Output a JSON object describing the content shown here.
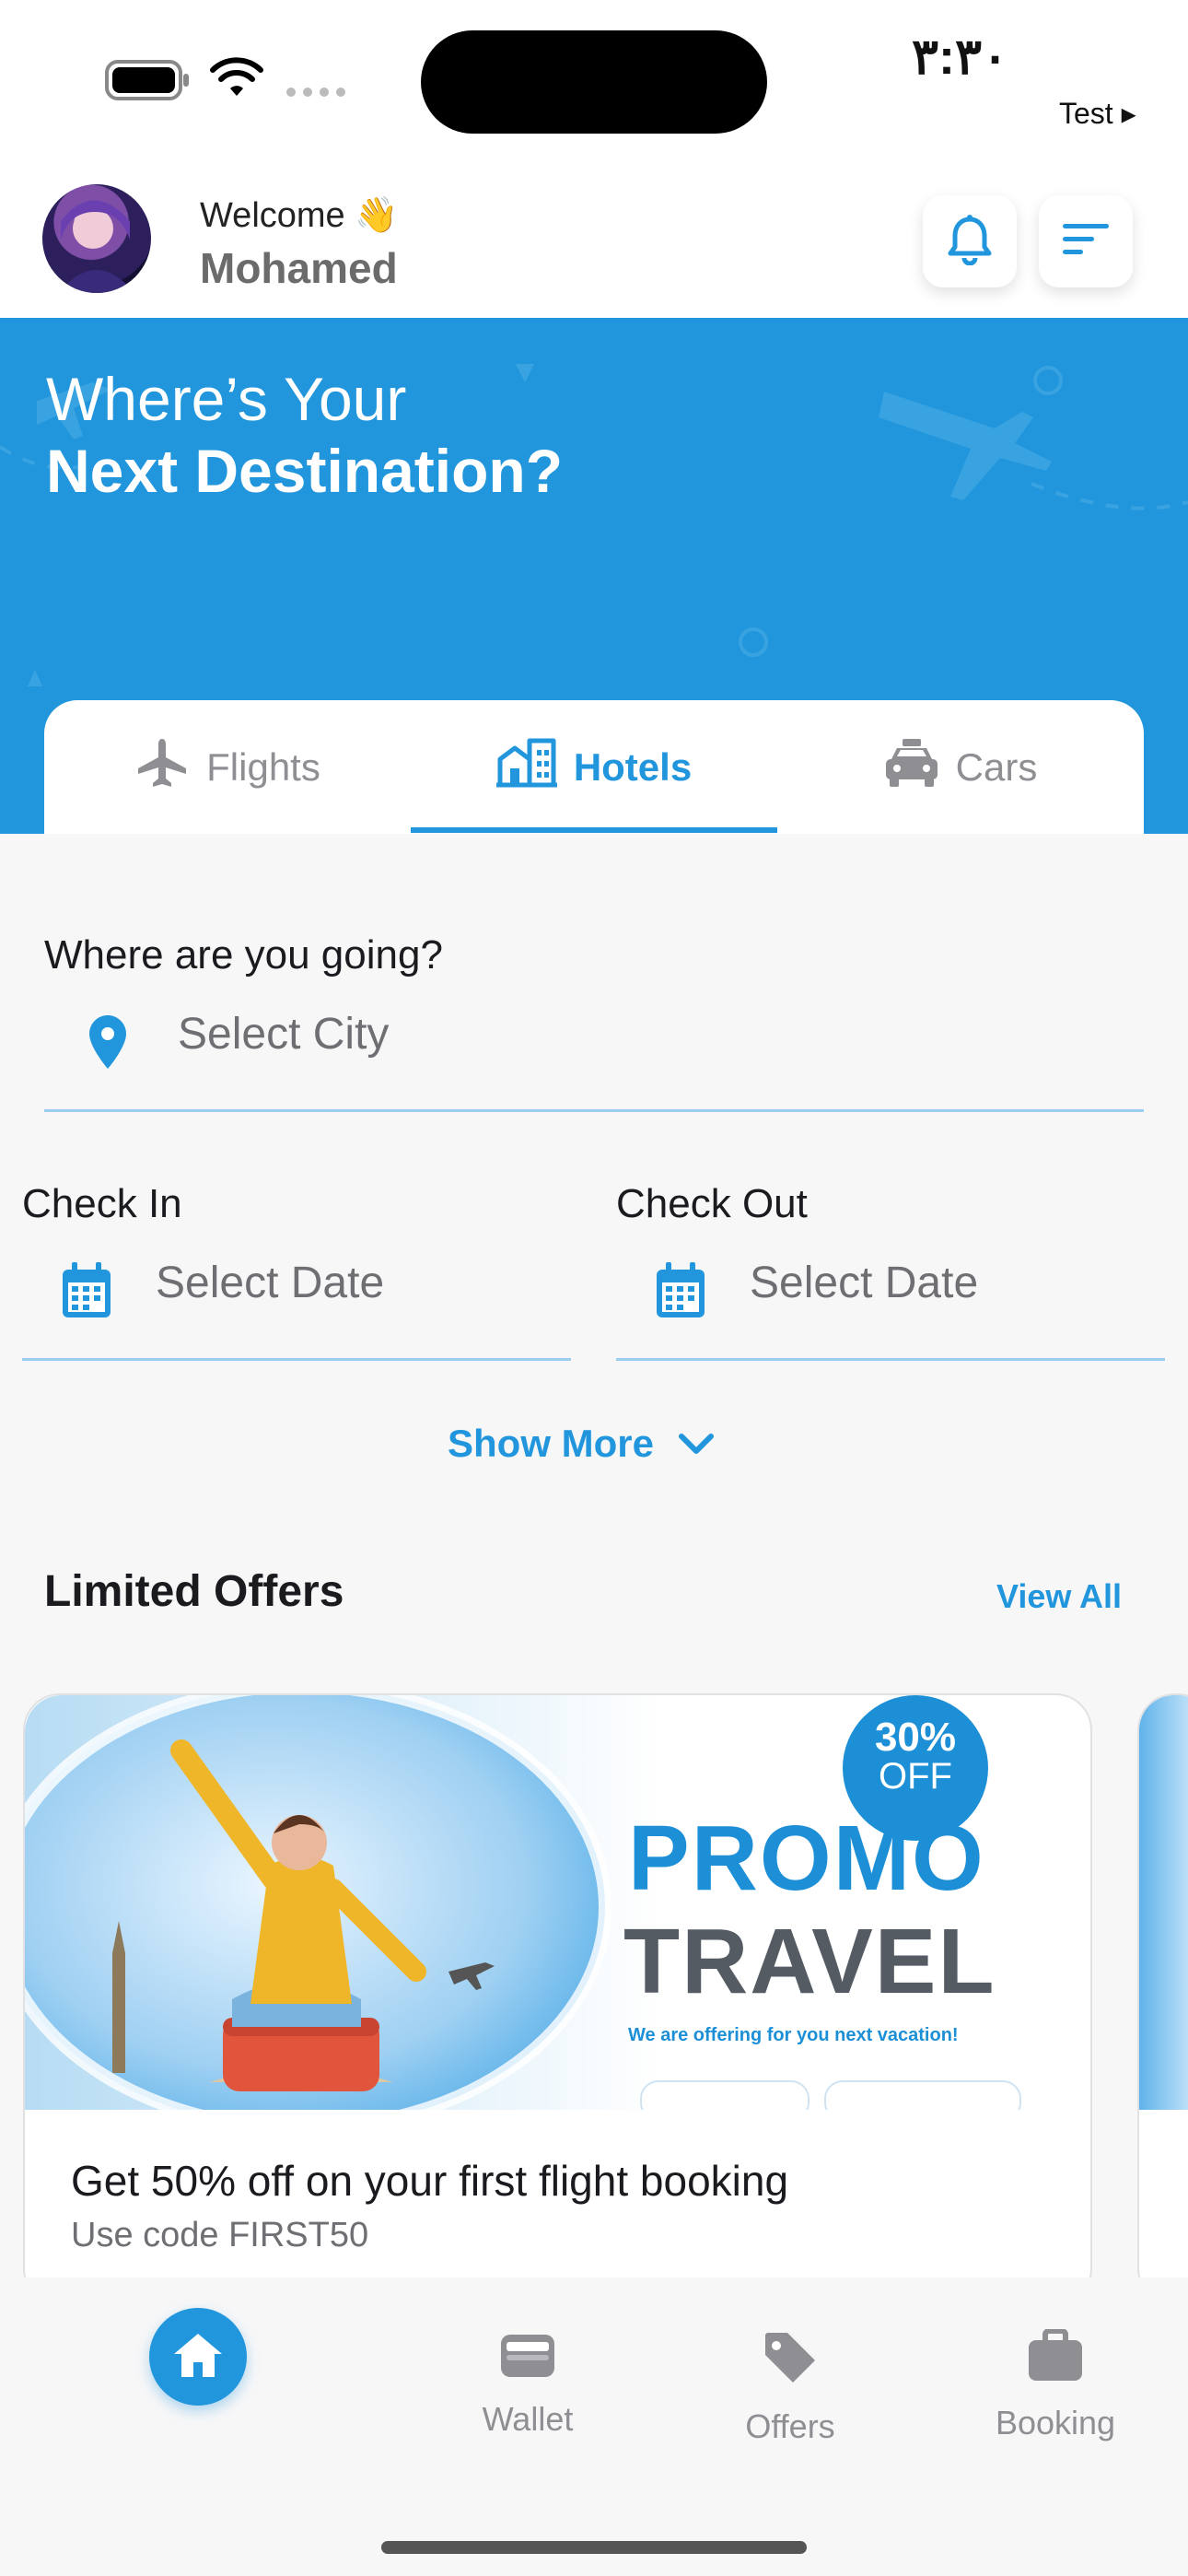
{
  "status_bar": {
    "time": "٣:٣٠",
    "carrier_label": "Test ▸"
  },
  "header": {
    "greeting": "Welcome 👋",
    "user_name": "Mohamed"
  },
  "hero": {
    "line1": "Where’s Your",
    "line2": "Next Destination?"
  },
  "tabs": [
    {
      "label": "Flights",
      "icon": "plane-icon",
      "active": false
    },
    {
      "label": "Hotels",
      "icon": "building-icon",
      "active": true
    },
    {
      "label": "Cars",
      "icon": "car-icon",
      "active": false
    }
  ],
  "search_form": {
    "destination_label": "Where are you going?",
    "destination_placeholder": "Select City",
    "check_in_label": "Check In",
    "check_in_placeholder": "Select Date",
    "check_out_label": "Check Out",
    "check_out_placeholder": "Select Date",
    "show_more": "Show More"
  },
  "offers": {
    "title": "Limited Offers",
    "view_all": "View All",
    "items": [
      {
        "banner_badge_pct": "30%",
        "banner_badge_off": "OFF",
        "banner_line1": "PROMO",
        "banner_line2": "TRAVEL",
        "banner_sub": "We are offering for you next vacation!",
        "title": "Get 50% off on your first flight booking",
        "subtitle": "Use code FIRST50"
      }
    ]
  },
  "bottom_nav": [
    {
      "label": "Home",
      "icon": "home-icon",
      "active": true
    },
    {
      "label": "Wallet",
      "icon": "wallet-icon",
      "active": false
    },
    {
      "label": "Offers",
      "icon": "tag-icon",
      "active": false
    },
    {
      "label": "Booking",
      "icon": "briefcase-icon",
      "active": false
    }
  ],
  "colors": {
    "primary": "#2196dc",
    "muted": "#8e8e93",
    "text": "#1b1b1f",
    "background": "#f7f7f8"
  }
}
